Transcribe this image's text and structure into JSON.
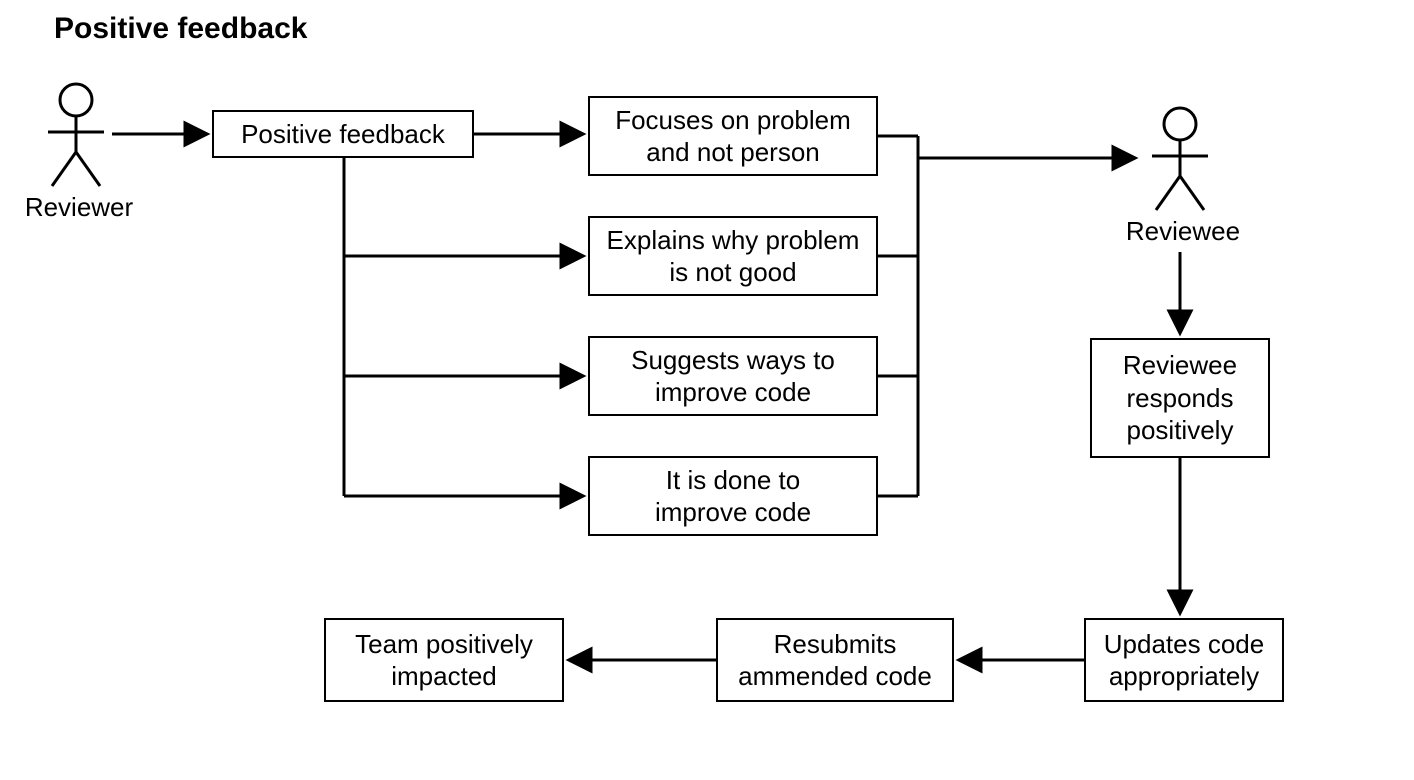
{
  "title": "Positive feedback",
  "actors": {
    "reviewer": "Reviewer",
    "reviewee": "Reviewee"
  },
  "nodes": {
    "positive_feedback": "Positive feedback",
    "focus": "Focuses on problem\nand not person",
    "explains": "Explains why problem\nis not good",
    "suggests": "Suggests ways to\nimprove code",
    "done": "It is done to\nimprove code",
    "responds": "Reviewee\nresponds\npositively",
    "updates": "Updates code\nappropriately",
    "resubmits": "Resubmits\nammended code",
    "team": "Team positively\nimpacted"
  }
}
